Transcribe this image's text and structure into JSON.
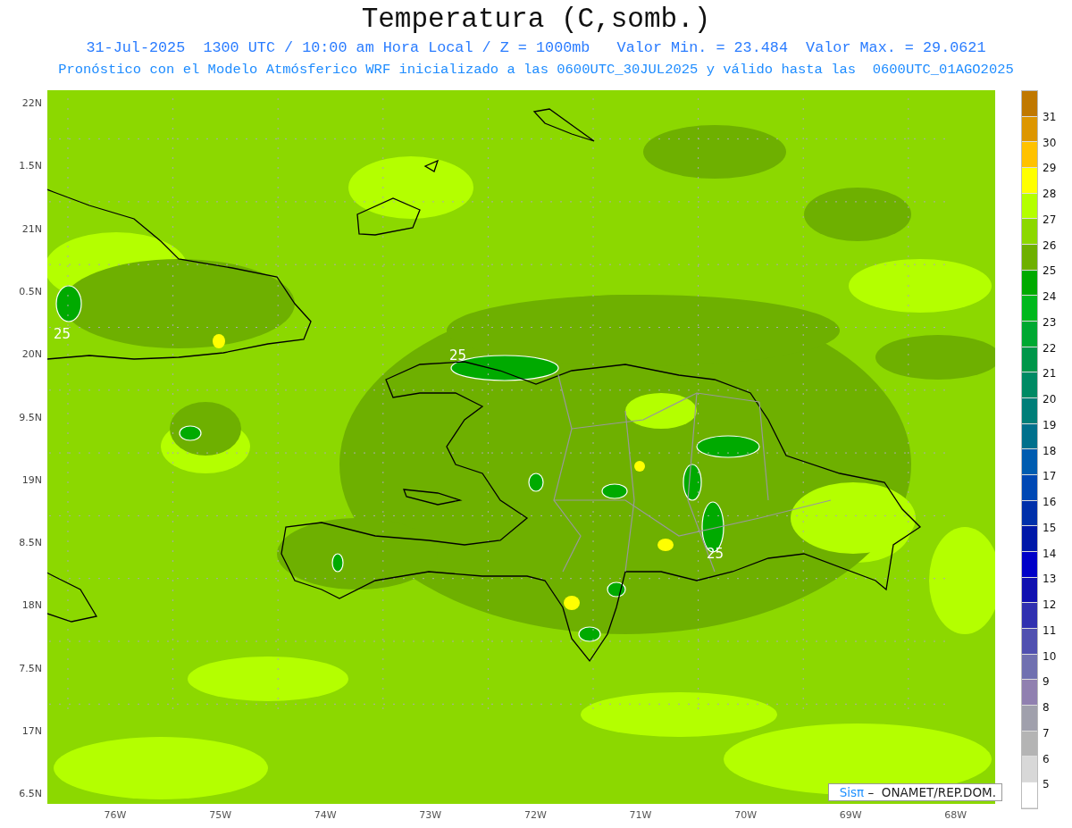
{
  "title": "Temperatura (C,somb.)",
  "subtitle_lines": [
    "31-Jul-2025  1300 UTC / 10:00 am Hora Local / Z = 1000mb   Valor Min. = 23.484  Valor Max. = 29.0621",
    "Pronóstico con el Modelo Atmósferico WRF inicializado a las 0600UTC_30JUL2025 y válido hasta las  0600UTC_01AGO2025"
  ],
  "map": {
    "latitude_labels": [
      "22N",
      "1.5N",
      "21N",
      "0.5N",
      "20N",
      "9.5N",
      "19N",
      "8.5N",
      "18N",
      "7.5N",
      "17N",
      "6.5N"
    ],
    "longitude_labels": [
      "76W",
      "75W",
      "74W",
      "73W",
      "72W",
      "71W",
      "70W",
      "69W",
      "68W"
    ],
    "contour_labels": [
      "25",
      "25",
      "25"
    ],
    "credit": {
      "logo": "Sisπ",
      "text": "–  ONAMET/REP.DOM."
    }
  },
  "color_scale": {
    "labels": [
      "31",
      "30",
      "29",
      "28",
      "27",
      "26",
      "25",
      "24",
      "23",
      "22",
      "21",
      "20",
      "19",
      "18",
      "17",
      "16",
      "15",
      "14",
      "13",
      "12",
      "11",
      "10",
      "9",
      "8",
      "7",
      "6",
      "5"
    ],
    "bins": [
      {
        "color": "#c07800"
      },
      {
        "color": "#dd9600"
      },
      {
        "color": "#ffc200"
      },
      {
        "color": "#ffff00"
      },
      {
        "color": "#b4ff00"
      },
      {
        "color": "#8cd800"
      },
      {
        "color": "#6eb000"
      },
      {
        "color": "#00aa00"
      },
      {
        "color": "#00b81c"
      },
      {
        "color": "#00a832"
      },
      {
        "color": "#00964a"
      },
      {
        "color": "#008a64"
      },
      {
        "color": "#007e78"
      },
      {
        "color": "#00708c"
      },
      {
        "color": "#005cb0"
      },
      {
        "color": "#0048b4"
      },
      {
        "color": "#0030aa"
      },
      {
        "color": "#0018a8"
      },
      {
        "color": "#0000c8"
      },
      {
        "color": "#1010b0"
      },
      {
        "color": "#3030b0"
      },
      {
        "color": "#5050b0"
      },
      {
        "color": "#7070b0"
      },
      {
        "color": "#9080b0"
      },
      {
        "color": "#a0a0ac"
      },
      {
        "color": "#b4b4b4"
      },
      {
        "color": "#d8d8d8"
      },
      {
        "color": "#ffffff"
      }
    ]
  }
}
